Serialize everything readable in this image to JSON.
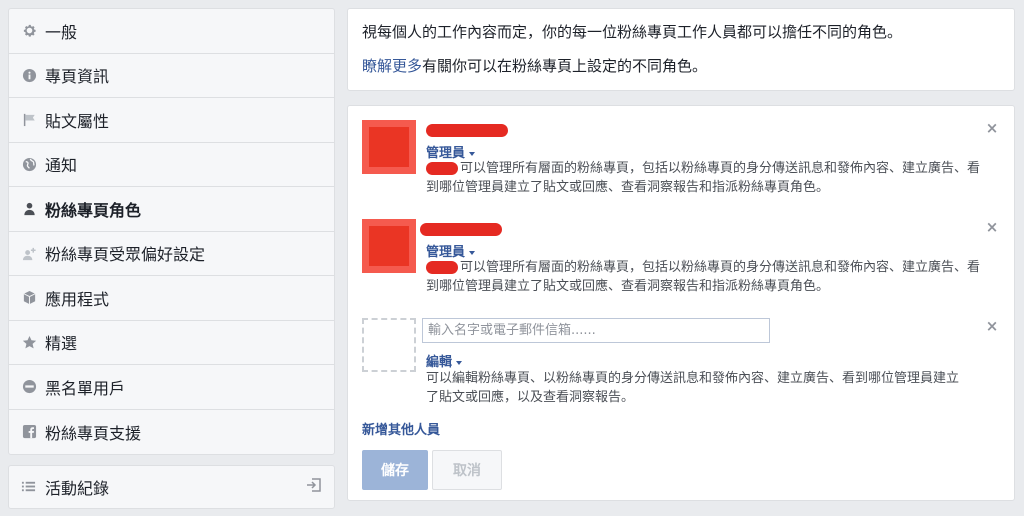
{
  "sidebar": {
    "items": [
      {
        "label": "一般",
        "icon": "gear-icon"
      },
      {
        "label": "專頁資訊",
        "icon": "info-icon"
      },
      {
        "label": "貼文屬性",
        "icon": "flag-icon"
      },
      {
        "label": "通知",
        "icon": "globe-icon"
      },
      {
        "label": "粉絲專頁角色",
        "icon": "person-icon",
        "active": true
      },
      {
        "label": "粉絲專頁受眾偏好設定",
        "icon": "person-add-icon"
      },
      {
        "label": "應用程式",
        "icon": "cube-icon"
      },
      {
        "label": "精選",
        "icon": "star-icon"
      },
      {
        "label": "黑名單用戶",
        "icon": "block-icon"
      },
      {
        "label": "粉絲專頁支援",
        "icon": "facebook-icon"
      }
    ],
    "activity_label": "活動紀錄"
  },
  "intro": {
    "line1": "視每個人的工作內容而定，你的每一位粉絲專頁工作人員都可以擔任不同的角色。",
    "learn_more": "瞭解更多",
    "line2_rest": "有關你可以在粉絲專頁上設定的不同角色。"
  },
  "roles": {
    "entries": [
      {
        "role": "管理員",
        "description": "可以管理所有層面的粉絲專頁，包括以粉絲專頁的身分傳送訊息和發佈內容、建立廣告、看到哪位管理員建立了貼文或回應、查看洞察報告和指派粉絲專頁角色。"
      },
      {
        "role": "管理員",
        "description": "可以管理所有層面的粉絲專頁，包括以粉絲專頁的身分傳送訊息和發佈內容、建立廣告、看到哪位管理員建立了貼文或回應、查看洞察報告和指派粉絲專頁角色。"
      }
    ],
    "new_entry": {
      "placeholder": "輸入名字或電子郵件信箱......",
      "role": "編輯",
      "description": "可以編輯粉絲專頁、以粉絲專頁的身分傳送訊息和發佈內容、建立廣告、看到哪位管理員建立了貼文或回應，以及查看洞察報告。"
    },
    "add_more": "新增其他人員",
    "save": "儲存",
    "cancel": "取消",
    "close_glyph": "×"
  },
  "colors": {
    "link": "#365899",
    "redaction": "#e52a22",
    "save_disabled": "#9cb4d8"
  }
}
